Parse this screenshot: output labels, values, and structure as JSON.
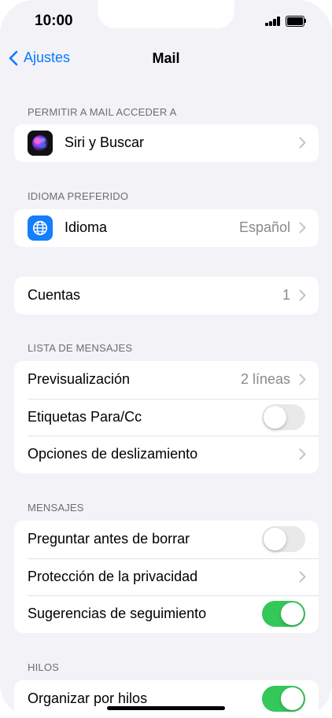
{
  "status_bar": {
    "time": "10:00"
  },
  "nav": {
    "back_label": "Ajustes",
    "title": "Mail"
  },
  "sections": {
    "access": {
      "header": "PERMITIR A MAIL ACCEDER A",
      "siri": {
        "label": "Siri y Buscar",
        "icon": "siri-icon"
      }
    },
    "language": {
      "header": "IDIOMA PREFERIDO",
      "idioma": {
        "label": "Idioma",
        "value": "Español",
        "icon": "globe-icon"
      }
    },
    "accounts": {
      "cuentas": {
        "label": "Cuentas",
        "value": "1"
      }
    },
    "message_list": {
      "header": "LISTA DE MENSAJES",
      "preview": {
        "label": "Previsualización",
        "value": "2 líneas"
      },
      "labels": {
        "label": "Etiquetas Para/Cc",
        "on": false
      },
      "swipe": {
        "label": "Opciones de deslizamiento"
      }
    },
    "messages": {
      "header": "MENSAJES",
      "ask_delete": {
        "label": "Preguntar antes de borrar",
        "on": false
      },
      "privacy": {
        "label": "Protección de la privacidad"
      },
      "follow_up": {
        "label": "Sugerencias de seguimiento",
        "on": true
      }
    },
    "threads": {
      "header": "HILOS",
      "organize": {
        "label": "Organizar por hilos",
        "on": true
      }
    }
  },
  "colors": {
    "accent": "#0a7aff",
    "toggle_on": "#34c759",
    "toggle_off": "#e9e9ea",
    "background": "#f2f2f7"
  }
}
